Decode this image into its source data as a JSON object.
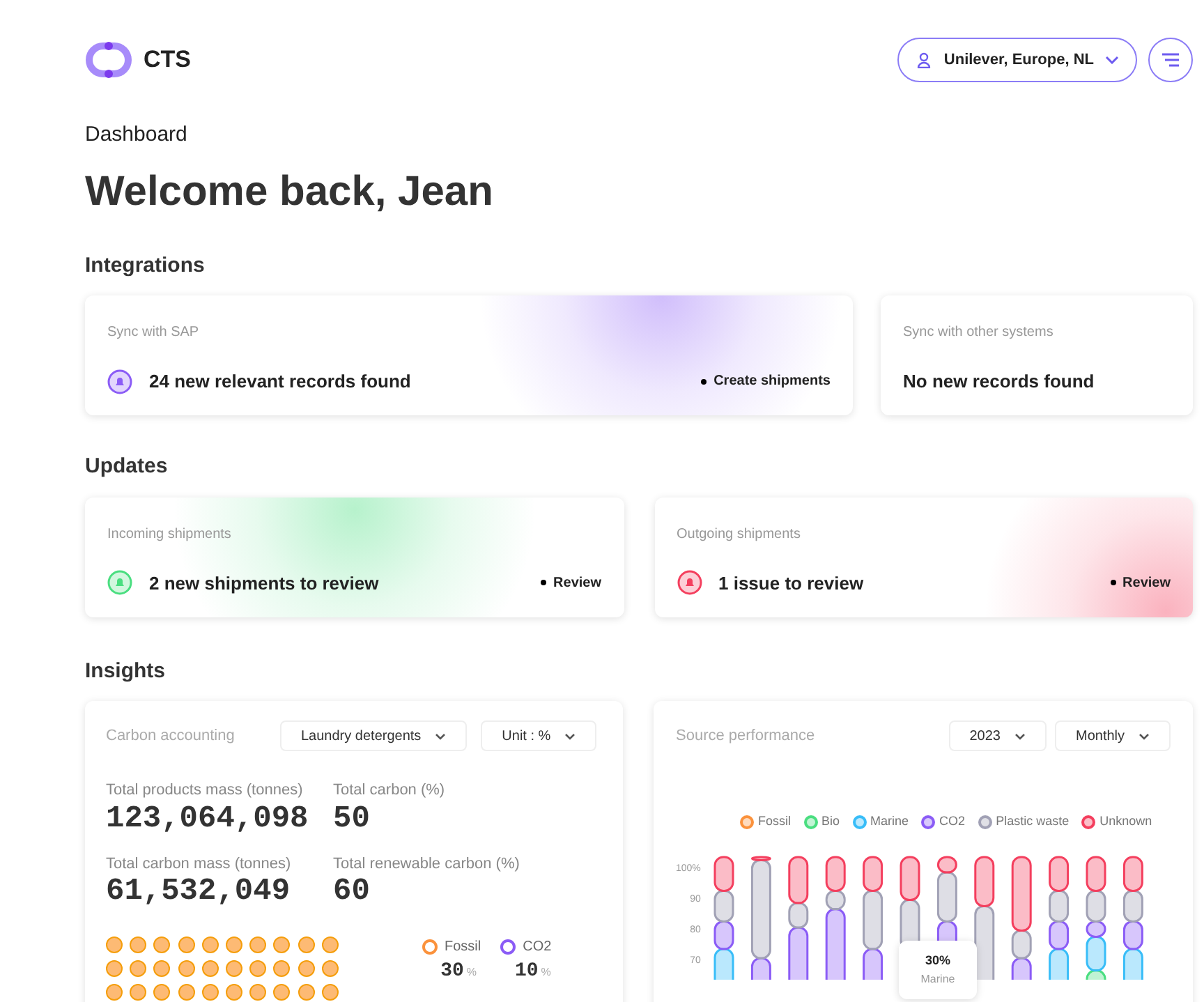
{
  "header": {
    "logo_text": "CTS",
    "account": "Unilever, Europe, NL"
  },
  "breadcrumb": "Dashboard",
  "greeting": "Welcome back, Jean",
  "integrations": {
    "title": "Integrations",
    "cards": [
      {
        "label": "Sync with SAP",
        "message": "24 new relevant records found",
        "action": "Create shipments",
        "color": "#8b5cf6"
      },
      {
        "label": "Sync with other systems",
        "message": "No new records found"
      }
    ]
  },
  "updates": {
    "title": "Updates",
    "cards": [
      {
        "label": "Incoming shipments",
        "message": "2 new shipments to review",
        "action": "Review",
        "color": "#4ade80"
      },
      {
        "label": "Outgoing shipments",
        "message": "1 issue to review",
        "action": "Review",
        "color": "#f43f5e"
      }
    ]
  },
  "insights": {
    "title": "Insights",
    "carbon": {
      "title": "Carbon accounting",
      "filters": [
        "Laundry detergents",
        "Unit : %"
      ],
      "stats": [
        {
          "label": "Total products mass (tonnes)",
          "value": "123,064,098"
        },
        {
          "label": "Total carbon (%)",
          "value": "50"
        },
        {
          "label": "Total carbon mass (tonnes)",
          "value": "61,532,049"
        },
        {
          "label": "Total renewable carbon (%)",
          "value": "60"
        }
      ],
      "legend": [
        {
          "name": "Fossil",
          "value": "30",
          "unit": "%",
          "color": "#fb923c"
        },
        {
          "name": "CO2",
          "value": "10",
          "unit": "%",
          "color": "#8b5cf6"
        }
      ]
    },
    "source": {
      "title": "Source performance",
      "filters": [
        "2023",
        "Monthly"
      ],
      "tooltip": {
        "value": "30%",
        "label": "Marine"
      },
      "y_axis_labels": [
        "100%",
        "90",
        "80",
        "70"
      ],
      "legend": [
        {
          "name": "Fossil",
          "color": "#fb923c"
        },
        {
          "name": "Bio",
          "color": "#4ade80"
        },
        {
          "name": "Marine",
          "color": "#38bdf8"
        },
        {
          "name": "CO2",
          "color": "#8b5cf6"
        },
        {
          "name": "Plastic waste",
          "color": "#a1a1b5"
        },
        {
          "name": "Unknown",
          "color": "#f43f5e"
        }
      ]
    }
  }
}
